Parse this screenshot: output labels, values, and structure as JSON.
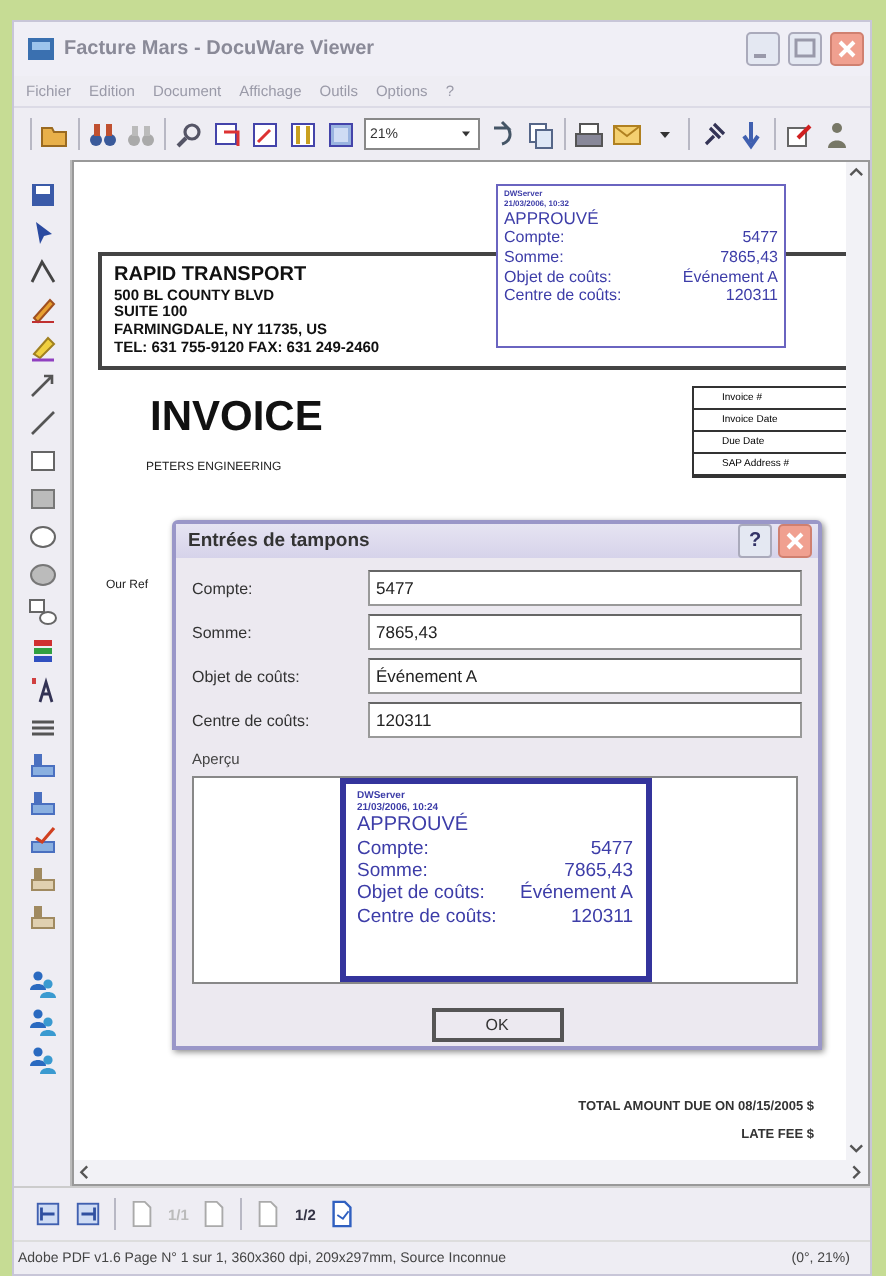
{
  "window": {
    "title": "Facture Mars - DocuWare Viewer"
  },
  "menu": [
    "Fichier",
    "Edition",
    "Document",
    "Affichage",
    "Outils",
    "Options",
    "?"
  ],
  "toolbar": {
    "zoom": "21%"
  },
  "document": {
    "stamp": {
      "header": [
        "DWServer",
        "21/03/2006, 10:32"
      ],
      "status": "APPROUVÉ",
      "fields": [
        {
          "label": "Compte:",
          "value": "5477"
        },
        {
          "label": "Somme:",
          "value": "7865,43"
        },
        {
          "label": "Objet de coûts:",
          "value": "Événement A"
        },
        {
          "label": "Centre de coûts:",
          "value": "120311"
        }
      ]
    },
    "company": [
      "RAPID TRANSPORT",
      "500 BL COUNTY BLVD",
      "SUITE 100",
      "FARMINGDALE, NY 11735, US",
      "TEL: 631 755-9120 FAX: 631 249-2460"
    ],
    "title": "INVOICE",
    "info_labels": [
      "Invoice #",
      "Invoice Date",
      "Due Date",
      "SAP Address #"
    ],
    "customer": "PETERS ENGINEERING",
    "reference": "Our Ref",
    "totals": [
      "TOTAL AMOUNT DUE ON 08/15/2005 $",
      "LATE FEE $"
    ]
  },
  "dialog": {
    "title": "Entrées de tampons",
    "help": "?",
    "fields": [
      {
        "label": "Compte:",
        "value": "5477"
      },
      {
        "label": "Somme:",
        "value": "7865,43"
      },
      {
        "label": "Objet de coûts:",
        "value": "Événement A"
      },
      {
        "label": "Centre de coûts:",
        "value": "120311"
      }
    ],
    "preview_label": "Aperçu",
    "preview": {
      "header": [
        "DWServer",
        "21/03/2006, 10:24"
      ],
      "status": "APPROUVÉ",
      "fields": [
        {
          "label": "Compte:",
          "value": "5477"
        },
        {
          "label": "Somme:",
          "value": "7865,43"
        },
        {
          "label": "Objet de coûts:",
          "value": "Événement A"
        },
        {
          "label": "Centre de coûts:",
          "value": "120311"
        }
      ]
    },
    "ok": "OK"
  },
  "page_nav": [
    {
      "text": "1/1",
      "disabled": true
    },
    {
      "text": "1/2",
      "disabled": false
    }
  ],
  "status_bar": {
    "info": "Adobe PDF v1.6 Page N° 1 sur 1, 360x360 dpi, 209x297mm,  Source Inconnue",
    "view": "(0°, 21%)"
  }
}
